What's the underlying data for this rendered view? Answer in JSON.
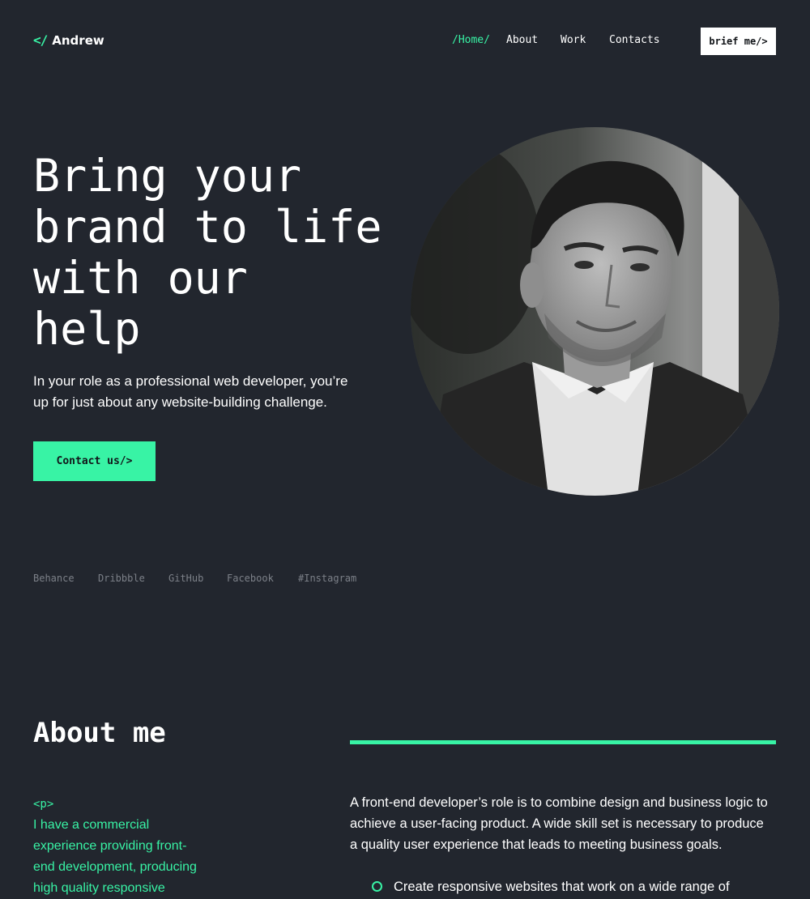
{
  "header": {
    "logo_mark": "</",
    "logo_name": "Andrew",
    "nav": [
      {
        "label": "/Home/",
        "active": true
      },
      {
        "label": "About"
      },
      {
        "label": "Work"
      },
      {
        "label": "Contacts"
      }
    ],
    "brief_button": "brief me/>"
  },
  "hero": {
    "title_lines": [
      "Bring your",
      "brand to life",
      "with our",
      "help"
    ],
    "subtitle_lines": [
      "In your role as a professional web developer, you’re",
      "up for just about any website-building challenge."
    ],
    "cta": "Contact us/>"
  },
  "socials": [
    "Behance",
    "Dribbble",
    "GitHub",
    "Facebook",
    "#Instagram"
  ],
  "about": {
    "title": "About me",
    "left_tag": "<p>",
    "left_lines": [
      "I have a commercial",
      "experience providing front-",
      "end development, producing",
      "high quality responsive"
    ],
    "right_lines": [
      "A front-end developer’s role is to combine design and business logic to",
      "achieve a user-facing product. A wide skill set is necessary to produce",
      "a quality user experience that leads to meeting business goals."
    ],
    "bullet": "Create responsive websites that work on a wide range of"
  },
  "colors": {
    "background": "#22262e",
    "accent": "#38f3a5",
    "muted": "#7c8088"
  }
}
